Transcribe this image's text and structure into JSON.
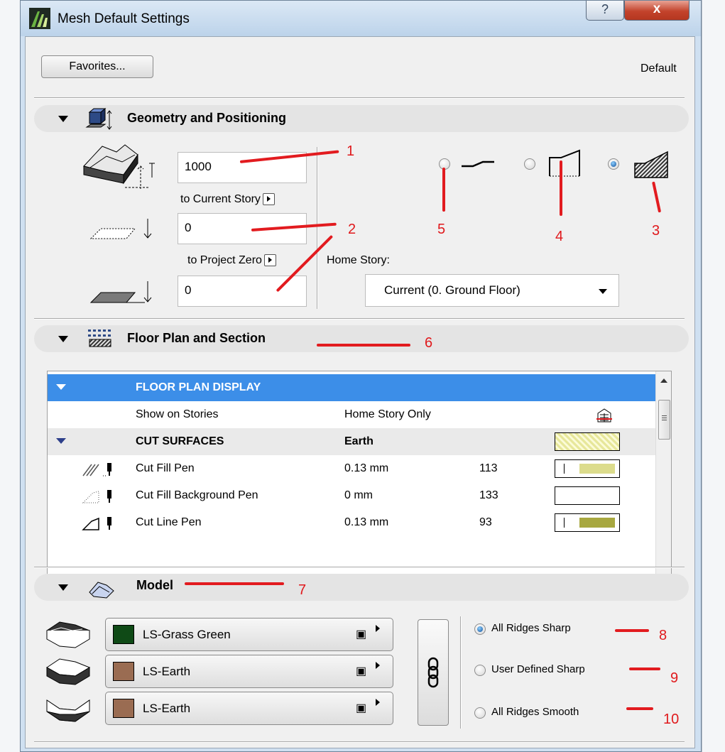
{
  "window": {
    "title": "Mesh Default Settings",
    "help_glyph": "?",
    "close_glyph": "x"
  },
  "toolbar": {
    "favorites_label": "Favorites...",
    "status_label": "Default"
  },
  "geometry": {
    "title": "Geometry and Positioning",
    "elevation_value": "1000",
    "to_current_story_label": "to Current Story",
    "offset_value": "0",
    "to_project_zero_label": "to Project Zero",
    "project_zero_value": "0",
    "home_story_label": "Home Story:",
    "home_story_value": "Current (0. Ground Floor)",
    "selected_option": 3
  },
  "floor_plan": {
    "title": "Floor Plan and Section",
    "rows": [
      {
        "kind": "group",
        "name": "FLOOR PLAN DISPLAY"
      },
      {
        "kind": "item",
        "name": "Show on Stories",
        "value": "Home Story Only"
      },
      {
        "kind": "group2",
        "name": "CUT SURFACES",
        "value": "Earth"
      },
      {
        "kind": "pen",
        "name": "Cut Fill Pen",
        "value": "0.13 mm",
        "pen": "113",
        "color": "#dcdc8c"
      },
      {
        "kind": "pen",
        "name": "Cut Fill Background Pen",
        "value": "0 mm",
        "pen": "133",
        "color": "#ffffff"
      },
      {
        "kind": "pen",
        "name": "Cut Line Pen",
        "value": "0.13 mm",
        "pen": "93",
        "color": "#a8a840"
      }
    ]
  },
  "model": {
    "title": "Model",
    "materials": [
      {
        "name": "LS-Grass Green",
        "color": "#0f4a16"
      },
      {
        "name": "LS-Earth",
        "color": "#9a6c52"
      },
      {
        "name": "LS-Earth",
        "color": "#9a6c52"
      }
    ],
    "ridge_options": [
      "All Ridges Sharp",
      "User Defined Sharp",
      "All Ridges Smooth"
    ],
    "ridge_selected": 0
  },
  "annotations": [
    "1",
    "2",
    "3",
    "4",
    "5",
    "6",
    "7",
    "8",
    "9",
    "10"
  ],
  "colors": {
    "selection_blue": "#3c8ee8",
    "annotation_red": "#e0191c"
  }
}
